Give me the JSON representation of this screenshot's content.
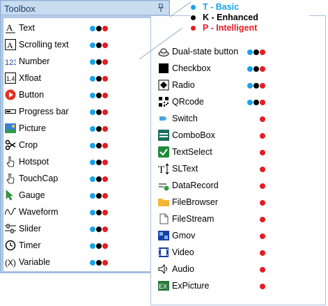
{
  "toolbox": {
    "title": "Toolbox"
  },
  "legend": [
    {
      "letter": "T",
      "text": "T - Basic",
      "color": "#1aa3e8"
    },
    {
      "letter": "K",
      "text": "K - Enhanced",
      "color": "#000000"
    },
    {
      "letter": "P",
      "text": "P - Intelligent",
      "color": "#e51c23"
    }
  ],
  "left_items": [
    {
      "label": "Text",
      "icon": "text-a-icon",
      "levels": [
        "T",
        "K",
        "P"
      ]
    },
    {
      "label": "Scrolling text",
      "icon": "scrolling-text-icon",
      "levels": [
        "T",
        "K",
        "P"
      ]
    },
    {
      "label": "Number",
      "icon": "number-123-icon",
      "levels": [
        "T",
        "K",
        "P"
      ]
    },
    {
      "label": "Xfloat",
      "icon": "xfloat-icon",
      "levels": [
        "T",
        "K",
        "P"
      ]
    },
    {
      "label": "Button",
      "icon": "button-play-icon",
      "levels": [
        "T",
        "K",
        "P"
      ]
    },
    {
      "label": "Progress bar",
      "icon": "progress-bar-icon",
      "levels": [
        "T",
        "K",
        "P"
      ]
    },
    {
      "label": "Picture",
      "icon": "picture-icon",
      "levels": [
        "T",
        "K",
        "P"
      ]
    },
    {
      "label": "Crop",
      "icon": "scissors-icon",
      "levels": [
        "T",
        "K",
        "P"
      ]
    },
    {
      "label": "Hotspot",
      "icon": "hand-pointer-icon",
      "levels": [
        "T",
        "K",
        "P"
      ]
    },
    {
      "label": "TouchCap",
      "icon": "hand-touch-icon",
      "levels": [
        "T",
        "K",
        "P"
      ]
    },
    {
      "label": "Gauge",
      "icon": "gauge-arrow-icon",
      "levels": [
        "T",
        "K",
        "P"
      ]
    },
    {
      "label": "Waveform",
      "icon": "waveform-icon",
      "levels": [
        "T",
        "K",
        "P"
      ]
    },
    {
      "label": "Slider",
      "icon": "slider-icon",
      "levels": [
        "T",
        "K",
        "P"
      ]
    },
    {
      "label": "Timer",
      "icon": "clock-icon",
      "levels": [
        "T",
        "K",
        "P"
      ]
    },
    {
      "label": "Variable",
      "icon": "variable-x-icon",
      "levels": [
        "T",
        "K",
        "P"
      ]
    }
  ],
  "right_items": [
    {
      "label": "Dual-state button",
      "icon": "dual-state-button-icon",
      "levels": [
        "T",
        "K",
        "P"
      ]
    },
    {
      "label": "Checkbox",
      "icon": "checkbox-icon",
      "levels": [
        "T",
        "K",
        "P"
      ]
    },
    {
      "label": "Radio",
      "icon": "radio-icon",
      "levels": [
        "T",
        "K",
        "P"
      ]
    },
    {
      "label": "QRcode",
      "icon": "qrcode-icon",
      "levels": [
        "T",
        "K",
        "P"
      ]
    },
    {
      "label": "Switch",
      "icon": "switch-icon",
      "levels": [
        "P"
      ]
    },
    {
      "label": "ComboBox",
      "icon": "combobox-icon",
      "levels": [
        "P"
      ]
    },
    {
      "label": "TextSelect",
      "icon": "text-select-check-icon",
      "levels": [
        "P"
      ]
    },
    {
      "label": "SLText",
      "icon": "sltext-icon",
      "levels": [
        "P"
      ]
    },
    {
      "label": "DataRecord",
      "icon": "data-record-icon",
      "levels": [
        "P"
      ]
    },
    {
      "label": "FileBrowser",
      "icon": "folder-icon",
      "levels": [
        "P"
      ]
    },
    {
      "label": "FileStream",
      "icon": "file-icon",
      "levels": [
        "P"
      ]
    },
    {
      "label": "Gmov",
      "icon": "gmov-icon",
      "levels": [
        "P"
      ]
    },
    {
      "label": "Video",
      "icon": "video-icon",
      "levels": [
        "P"
      ]
    },
    {
      "label": "Audio",
      "icon": "speaker-icon",
      "levels": [
        "P"
      ]
    },
    {
      "label": "ExPicture",
      "icon": "expicture-icon",
      "levels": [
        "P"
      ]
    }
  ]
}
